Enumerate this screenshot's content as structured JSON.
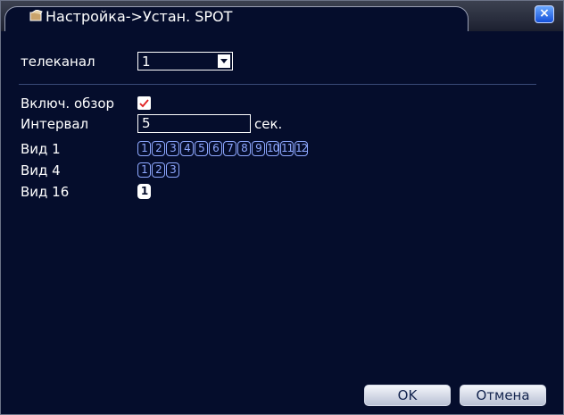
{
  "window": {
    "title": "Настройка->Устан. SPOT",
    "close_label": "×"
  },
  "form": {
    "channel_label": "телеканал",
    "channel_value": "1",
    "tour_label": "Включ. обзор",
    "tour_checked": true,
    "interval_label": "Интервал",
    "interval_value": "5",
    "interval_unit": "сек.",
    "view1_label": "Вид 1",
    "view1_channels": [
      "1",
      "2",
      "3",
      "4",
      "5",
      "6",
      "7",
      "8",
      "9",
      "10",
      "11",
      "12"
    ],
    "view4_label": "Вид 4",
    "view4_channels": [
      "1",
      "2",
      "3"
    ],
    "view16_label": "Вид 16",
    "view16_channels": [
      "1"
    ]
  },
  "buttons": {
    "ok_label": "OK",
    "cancel_label": "Отмена"
  },
  "colors": {
    "background": "#050d2c",
    "accent": "#8ea8ff",
    "close_button": "#1450d8"
  }
}
